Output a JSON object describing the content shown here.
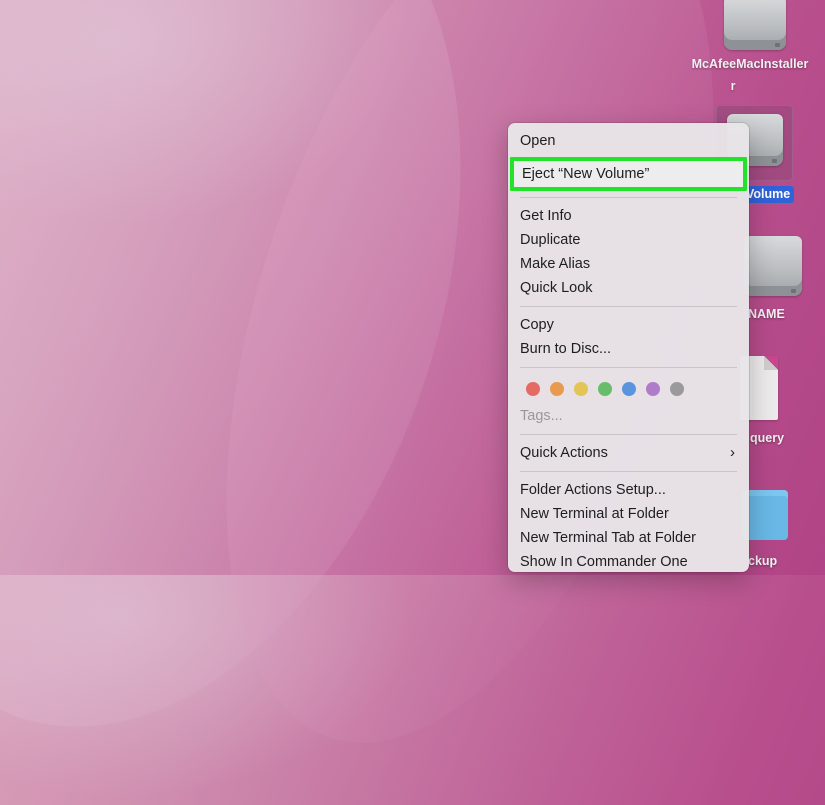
{
  "desktop": {
    "items": [
      {
        "label": "McAfeeMacInstaller"
      },
      {
        "label": "Volume"
      },
      {
        "label": "NAME"
      },
      {
        "label": "query"
      },
      {
        "label": "ckup"
      }
    ]
  },
  "context_menu": {
    "open": "Open",
    "eject": "Eject “New Volume”",
    "get_info": "Get Info",
    "duplicate": "Duplicate",
    "make_alias": "Make Alias",
    "quick_look": "Quick Look",
    "copy": "Copy",
    "burn": "Burn to Disc...",
    "tag_colors": [
      "#e46a63",
      "#e89b4e",
      "#e3c455",
      "#67bd6a",
      "#5a93de",
      "#b07bc8",
      "#9a9a9a"
    ],
    "tags": "Tags...",
    "quick_actions": "Quick Actions",
    "folder_actions": "Folder Actions Setup...",
    "new_terminal": "New Terminal at Folder",
    "new_terminal_tab": "New Terminal Tab at Folder",
    "commander_one": "Show In Commander One"
  }
}
